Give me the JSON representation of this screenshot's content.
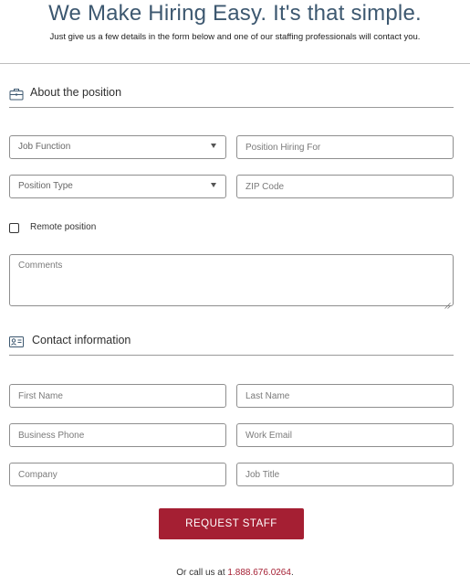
{
  "header": {
    "title": "We Make Hiring Easy. It's that simple.",
    "subtitle": "Just give us a few details in the form below and one of our staffing professionals will contact you."
  },
  "sections": {
    "position": {
      "label": "About the position",
      "icon": "briefcase-icon"
    },
    "contact": {
      "label": "Contact information",
      "icon": "contact-card-icon"
    }
  },
  "fields": {
    "job_function": {
      "value": "Job Function"
    },
    "position_hiring_for": {
      "placeholder": "Position Hiring For"
    },
    "position_type": {
      "value": "Position Type"
    },
    "zip_code": {
      "placeholder": "ZIP Code"
    },
    "remote_label": "Remote position",
    "comments": {
      "placeholder": "Comments"
    },
    "first_name": {
      "placeholder": "First Name"
    },
    "last_name": {
      "placeholder": "Last Name"
    },
    "business_phone": {
      "placeholder": "Business Phone"
    },
    "work_email": {
      "placeholder": "Work Email"
    },
    "company": {
      "placeholder": "Company"
    },
    "job_title": {
      "placeholder": "Job Title"
    }
  },
  "submit_label": "REQUEST STAFF",
  "footer": {
    "prefix": "Or call us at ",
    "phone": "1.888.676.0264",
    "suffix": "."
  },
  "colors": {
    "title": "#3d5870",
    "accent": "#a51f33"
  }
}
